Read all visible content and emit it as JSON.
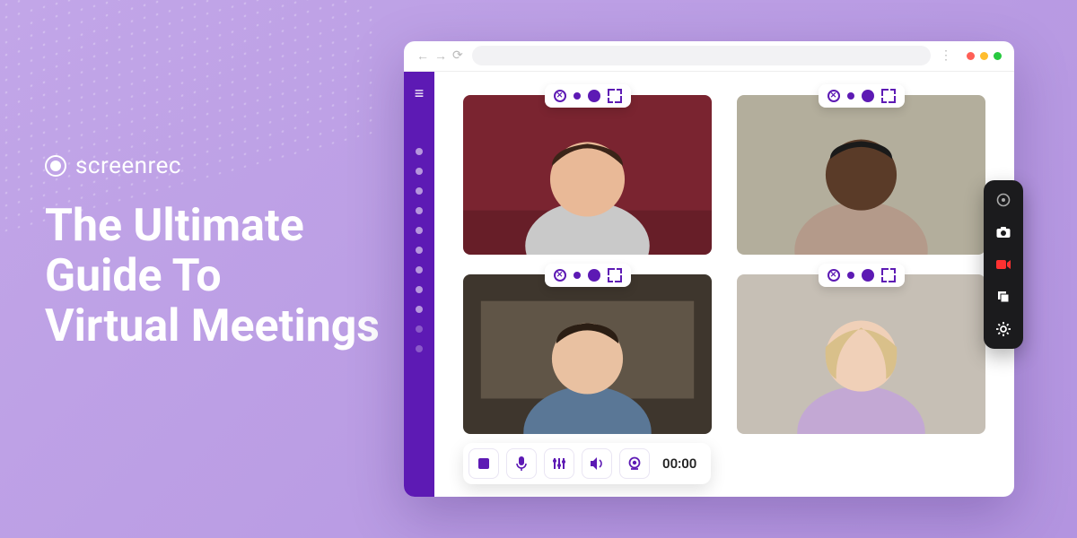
{
  "brand": {
    "name": "screenrec"
  },
  "title_lines": [
    "The Ultimate",
    "Guide To",
    "Virtual Meetings"
  ],
  "browser": {
    "nav_icons": {
      "back": "←",
      "forward": "→",
      "reload": "⟳"
    },
    "traffic_lights": [
      "red",
      "yellow",
      "green"
    ]
  },
  "sidebar": {
    "dot_count": 11
  },
  "tiles": [
    {
      "id": "participant-1",
      "bg": "#7a2430",
      "skin": "#e9b997",
      "shirt": "#c9c9c9",
      "hair": "#3b2418"
    },
    {
      "id": "participant-2",
      "bg": "#b3ae9c",
      "skin": "#5a3b28",
      "shirt": "#b49a8a",
      "hair": "#1a1a1a"
    },
    {
      "id": "participant-3",
      "bg": "#3e362d",
      "skin": "#e9c1a1",
      "shirt": "#5a7796",
      "hair": "#2b1e14"
    },
    {
      "id": "participant-4",
      "bg": "#c6bfb5",
      "skin": "#f0d0b8",
      "shirt": "#c3a8d4",
      "hair": "#d9c08a"
    }
  ],
  "pill_controls": {
    "close": "close-icon",
    "dot_small": "record-dot-small",
    "dot_large": "record-dot-large",
    "fullscreen": "fullscreen-icon"
  },
  "rec_toolbar": {
    "stop": "stop-icon",
    "mic": "mic-icon",
    "levels": "levels-icon",
    "speaker": "speaker-icon",
    "camera": "webcam-icon",
    "timer": "00:00"
  },
  "float_panel": {
    "items": [
      {
        "name": "link-icon",
        "glyph": "⟲"
      },
      {
        "name": "camera-icon",
        "glyph": "📷"
      },
      {
        "name": "record-icon",
        "glyph": "▮"
      },
      {
        "name": "copy-icon",
        "glyph": "❐"
      },
      {
        "name": "gear-icon",
        "glyph": "⚙"
      }
    ]
  },
  "colors": {
    "accent": "#5d1ab4"
  }
}
